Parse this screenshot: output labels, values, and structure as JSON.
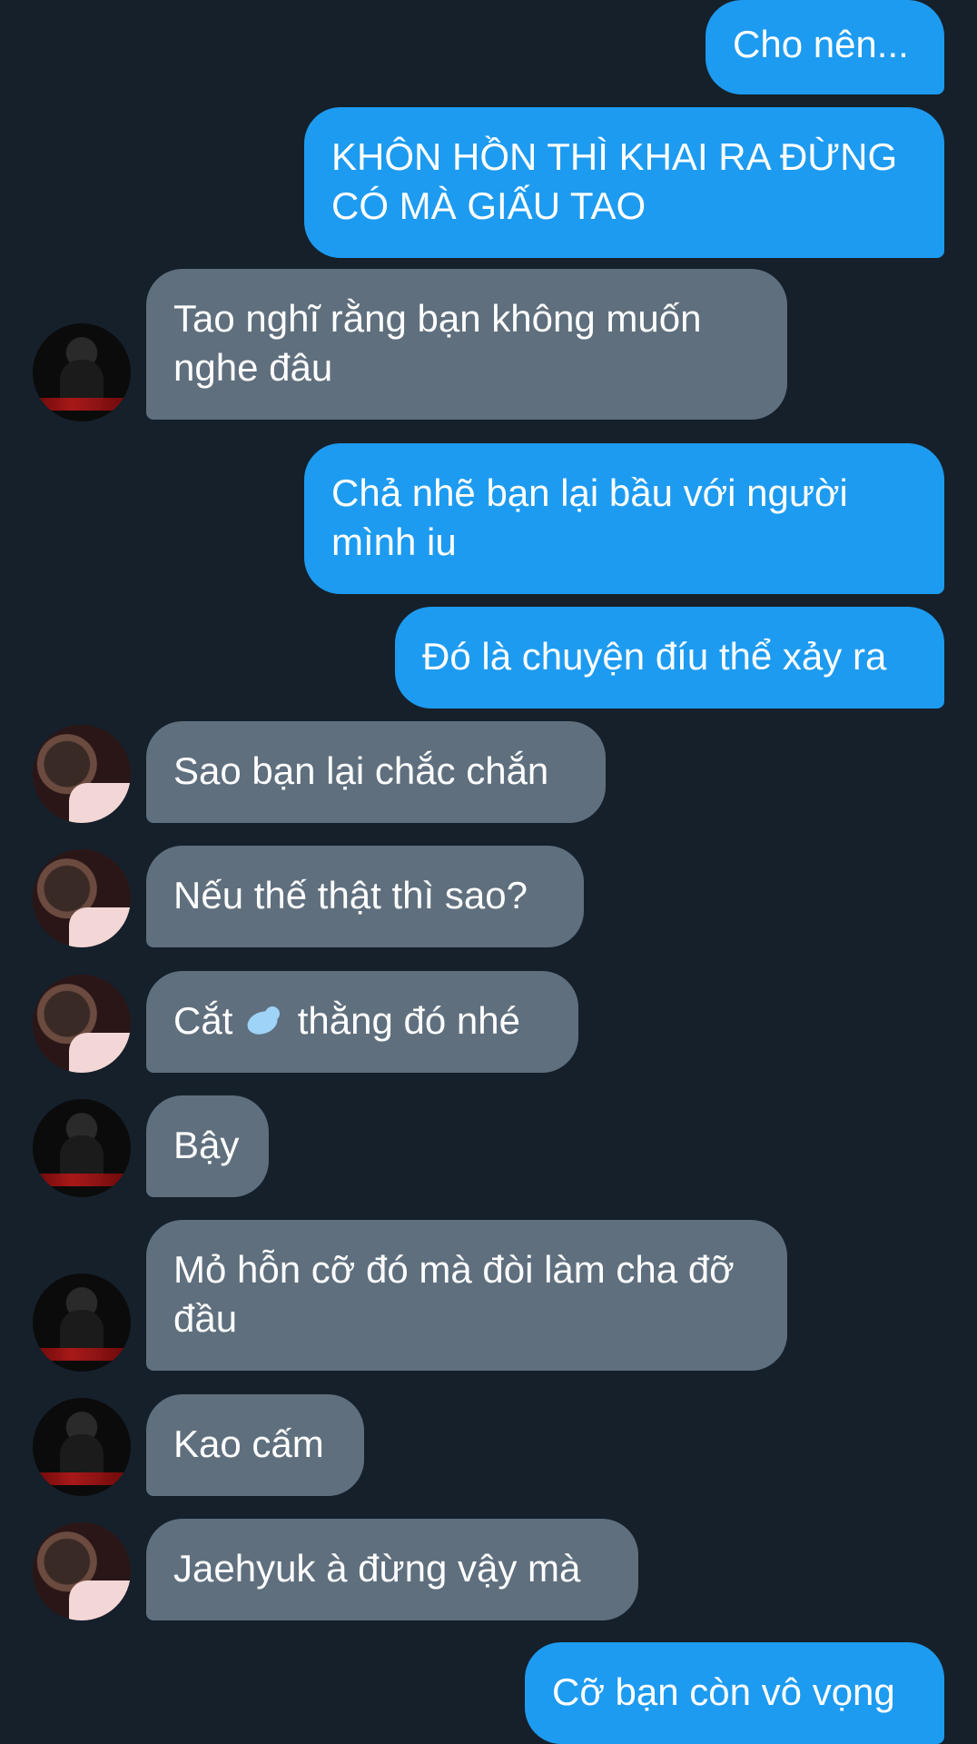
{
  "messages": [
    {
      "id": "m1",
      "side": "sent",
      "text": "Cho nên..."
    },
    {
      "id": "m2",
      "side": "sent",
      "text": "KHÔN HỒN THÌ KHAI RA ĐỪNG CÓ MÀ GIẤU TAO"
    },
    {
      "id": "m3",
      "side": "received",
      "avatar": "dark-avatar",
      "text": "Tao nghĩ rằng bạn không muốn nghe đâu"
    },
    {
      "id": "m4",
      "side": "sent",
      "text": "Chả nhẽ bạn lại bầu với người mình iu"
    },
    {
      "id": "m5",
      "side": "sent",
      "text": "Đó là chuyện đíu thể xảy ra"
    },
    {
      "id": "m6",
      "side": "received",
      "avatar": "pink-avatar",
      "text": "Sao bạn lại chắc chắn"
    },
    {
      "id": "m7",
      "side": "received",
      "avatar": "pink-avatar",
      "text": "Nếu thế thật thì sao?"
    },
    {
      "id": "m8",
      "side": "received",
      "avatar": "pink-avatar",
      "text_before": "Cắt ",
      "emoji": "bird-emoji",
      "text_after": " thằng đó nhé"
    },
    {
      "id": "m9",
      "side": "received",
      "avatar": "dark-avatar",
      "text": "Bậy"
    },
    {
      "id": "m10",
      "side": "received",
      "avatar": "dark-avatar",
      "text": "Mỏ hỗn cỡ đó mà đòi làm cha đỡ đầu"
    },
    {
      "id": "m11",
      "side": "received",
      "avatar": "dark-avatar",
      "text": "Kao cấm"
    },
    {
      "id": "m12",
      "side": "received",
      "avatar": "pink-avatar",
      "text": "Jaehyuk à đừng vậy mà"
    },
    {
      "id": "m13",
      "side": "sent",
      "text": "Cỡ bạn còn vô vọng"
    }
  ],
  "colors": {
    "background": "#15202b",
    "sent_bubble": "#1d9bf0",
    "received_bubble": "#5f6f7e",
    "text": "#ffffff"
  }
}
